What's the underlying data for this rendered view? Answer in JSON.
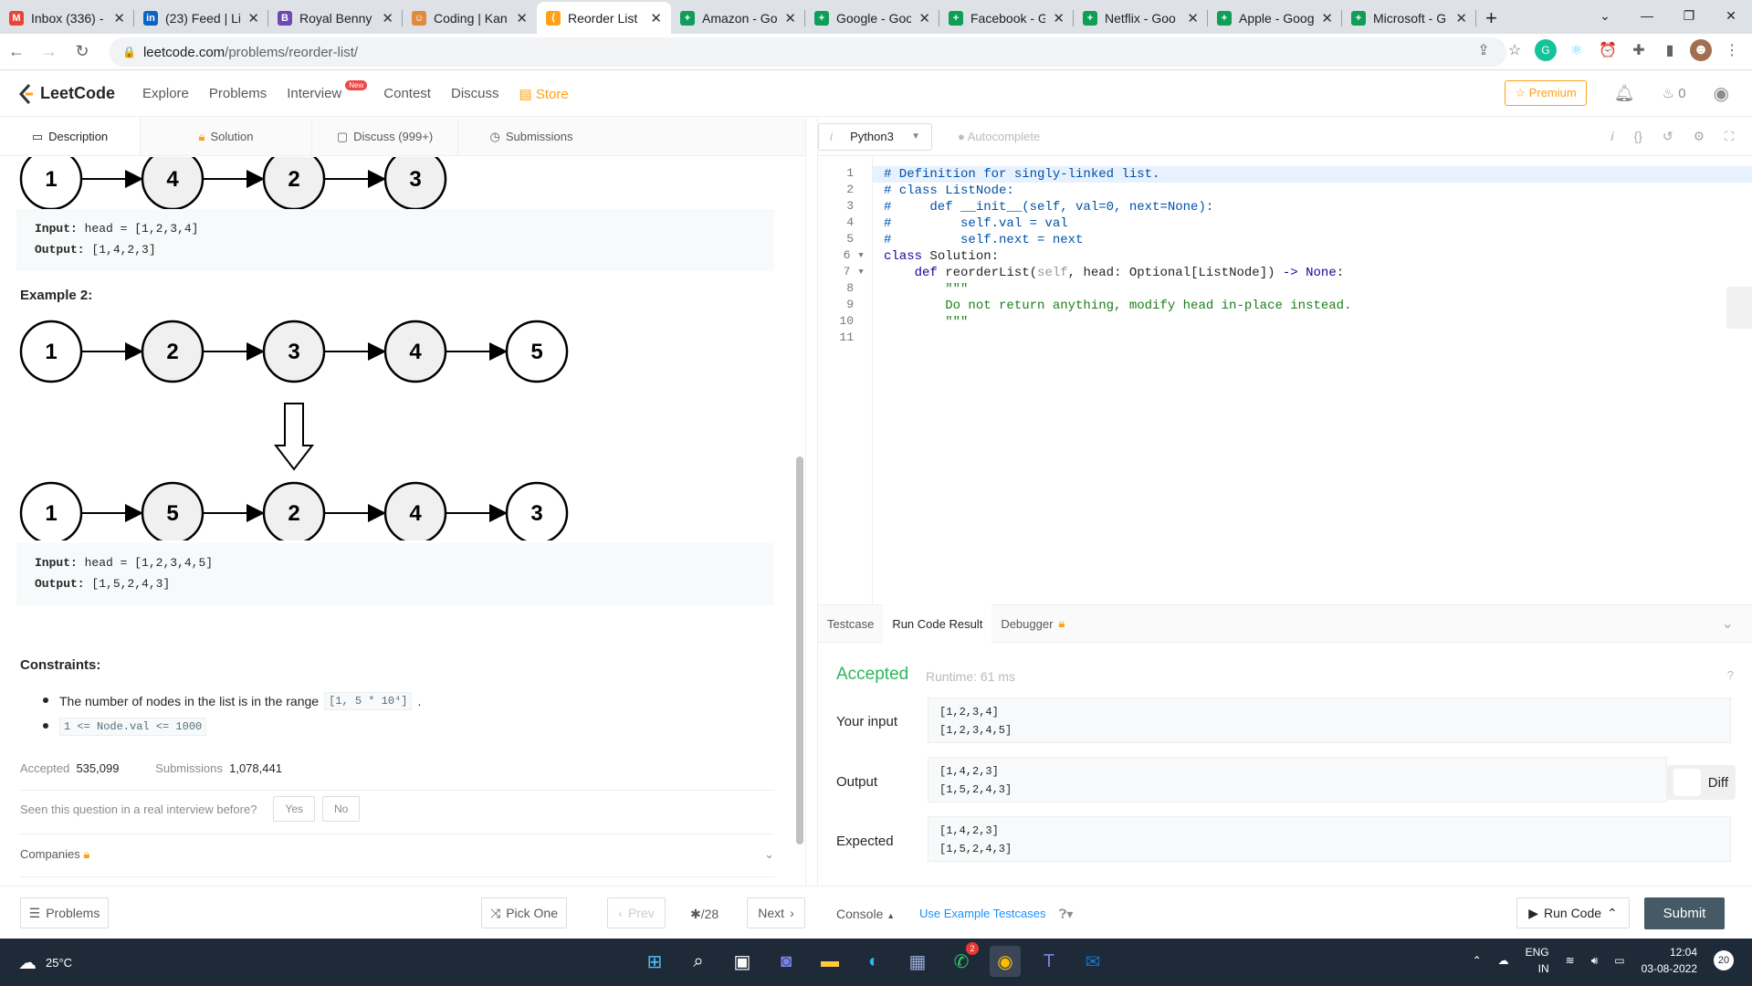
{
  "browser": {
    "tabs": [
      {
        "title": "Inbox (336) -",
        "icon": "gmail-icon",
        "color": "#ea4335",
        "glyph": "M"
      },
      {
        "title": "(23) Feed | Li",
        "icon": "linkedin-icon",
        "color": "#0a66c2",
        "glyph": "in"
      },
      {
        "title": "Royal Benny",
        "icon": "b-icon",
        "color": "#6c4ab6",
        "glyph": "B"
      },
      {
        "title": "Coding | Kan",
        "icon": "avatar-icon",
        "color": "#e08a3c",
        "glyph": "☺"
      },
      {
        "title": "Reorder List",
        "icon": "leetcode-icon",
        "color": "#ffa116",
        "glyph": "⟨"
      },
      {
        "title": "Amazon - Go",
        "icon": "sheets-icon",
        "color": "#0f9d58",
        "glyph": "+"
      },
      {
        "title": "Google - Goo",
        "icon": "sheets-icon",
        "color": "#0f9d58",
        "glyph": "+"
      },
      {
        "title": "Facebook - G",
        "icon": "sheets-icon",
        "color": "#0f9d58",
        "glyph": "+"
      },
      {
        "title": "Netflix - Goo",
        "icon": "sheets-icon",
        "color": "#0f9d58",
        "glyph": "+"
      },
      {
        "title": "Apple - Goog",
        "icon": "sheets-icon",
        "color": "#0f9d58",
        "glyph": "+"
      },
      {
        "title": "Microsoft - G",
        "icon": "sheets-icon",
        "color": "#0f9d58",
        "glyph": "+"
      }
    ],
    "url_host": "leetcode.com",
    "url_path": "/problems/reorder-list/"
  },
  "nav": {
    "brand": "LeetCode",
    "links": [
      "Explore",
      "Problems",
      "Interview",
      "Contest",
      "Discuss"
    ],
    "new_badge": "New",
    "store": "Store",
    "premium": "Premium",
    "streak": "0"
  },
  "left_tabs": [
    "Description",
    "Solution",
    "Discuss (999+)",
    "Submissions"
  ],
  "example1": {
    "nodes": [
      "1",
      "4",
      "2",
      "3"
    ],
    "input_label": "Input:",
    "input_value": "head = [1,2,3,4]",
    "output_label": "Output:",
    "output_value": "[1,4,2,3]"
  },
  "example2": {
    "heading": "Example 2:",
    "nodes_before": [
      "1",
      "2",
      "3",
      "4",
      "5"
    ],
    "nodes_after": [
      "1",
      "5",
      "2",
      "4",
      "3"
    ],
    "input_label": "Input:",
    "input_value": "head = [1,2,3,4,5]",
    "output_label": "Output:",
    "output_value": "[1,5,2,4,3]"
  },
  "constraints": {
    "heading": "Constraints:",
    "item1_text": "The number of nodes in the list is in the range",
    "item1_code": "[1, 5 * 10⁴]",
    "item1_end": ".",
    "item2_code": "1 <= Node.val <= 1000"
  },
  "stats": {
    "accepted_label": "Accepted",
    "accepted_value": "535,099",
    "submissions_label": "Submissions",
    "submissions_value": "1,078,441"
  },
  "interview_question": "Seen this question in a real interview before?",
  "yes": "Yes",
  "no": "No",
  "companies": "Companies",
  "editor": {
    "language": "Python3",
    "autocomplete": "Autocomplete",
    "line_numbers": [
      "1",
      "2",
      "3",
      "4",
      "5",
      "6",
      "7",
      "8",
      "9",
      "10",
      "11"
    ],
    "lines": [
      "# Definition for singly-linked list.",
      "# class ListNode:",
      "#     def __init__(self, val=0, next=None):",
      "#         self.val = val",
      "#         self.next = next",
      "class Solution:",
      "    def reorderList(self, head: Optional[ListNode]) -> None:",
      "        \"\"\"",
      "        Do not return anything, modify head in-place instead.",
      "        \"\"\"",
      ""
    ]
  },
  "result": {
    "tabs": [
      "Testcase",
      "Run Code Result",
      "Debugger"
    ],
    "status": "Accepted",
    "runtime": "Runtime: 61 ms",
    "your_input_label": "Your input",
    "your_input": [
      "[1,2,3,4]",
      "[1,2,3,4,5]"
    ],
    "output_label": "Output",
    "output": [
      "[1,4,2,3]",
      "[1,5,2,4,3]"
    ],
    "expected_label": "Expected",
    "expected": [
      "[1,4,2,3]",
      "[1,5,2,4,3]"
    ],
    "diff": "Diff",
    "accepted_color": "#2db55d"
  },
  "bottom": {
    "problems": "Problems",
    "pick_one": "Pick One",
    "prev": "Prev",
    "page": "/28",
    "next": "Next",
    "console": "Console",
    "use_example": "Use Example Testcases",
    "run_code": "Run Code",
    "submit": "Submit"
  },
  "taskbar": {
    "temp": "25°C",
    "lang1": "ENG",
    "lang2": "IN",
    "time": "12:04",
    "date": "03-08-2022",
    "notif_count": "20",
    "whatsapp_badge": "2"
  }
}
